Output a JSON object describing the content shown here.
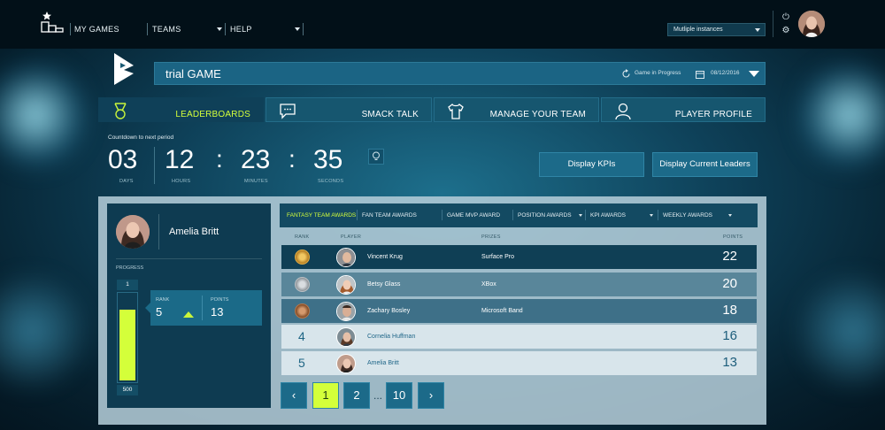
{
  "nav": {
    "my_games": "MY GAMES",
    "teams": "TEAMS",
    "help": "HELP",
    "instances": "Mutliple instances"
  },
  "game": {
    "title": "trial GAME",
    "status": "Game in Progress",
    "date": "08/12/2016"
  },
  "tabs": [
    {
      "label": "LEADERBOARDS",
      "icon": "medal-icon",
      "active": true
    },
    {
      "label": "SMACK TALK",
      "icon": "chat-icon",
      "active": false
    },
    {
      "label": "MANAGE YOUR TEAM",
      "icon": "jersey-icon",
      "active": false
    },
    {
      "label": "PLAYER PROFILE",
      "icon": "person-icon",
      "active": false
    }
  ],
  "countdown": {
    "label": "Countdown to next period",
    "days": "03",
    "hours": "12",
    "minutes": "23",
    "seconds": "35",
    "days_label": "DAYS",
    "hours_label": "HOURS",
    "minutes_label": "MINUTES",
    "seconds_label": "SECONDS"
  },
  "buttons": {
    "display_kpis": "Display KPIs",
    "display_leaders": "Display Current Leaders"
  },
  "profile": {
    "name": "Amelia Britt",
    "progress_label": "PROGRESS",
    "progress_max": "1",
    "progress_min": "500",
    "progress_fraction": 0.82,
    "rank_label": "RANK",
    "rank": "5",
    "points_label": "POINTS",
    "points": "13"
  },
  "awards_tabs": [
    "FANTASY TEAM AWARDS",
    "FAN TEAM AWARDS",
    "GAME MVP AWARD",
    "POSITION AWARDS",
    "KPI AWARDS",
    "WEEKLY AWARDS"
  ],
  "columns": {
    "rank": "RANK",
    "player": "PLAYER",
    "prizes": "PRIZES",
    "points": "POINTS"
  },
  "leaderboard": [
    {
      "rank": "1",
      "player": "Vincent Krug",
      "prize": "Surface Pro",
      "points": "22",
      "medal": "gold"
    },
    {
      "rank": "2",
      "player": "Betsy Glass",
      "prize": "XBox",
      "points": "20",
      "medal": "silver"
    },
    {
      "rank": "3",
      "player": "Zachary Bosley",
      "prize": "Microsoft Band",
      "points": "18",
      "medal": "bronze"
    },
    {
      "rank": "4",
      "player": "Cornelia Huffman",
      "prize": "",
      "points": "16",
      "medal": ""
    },
    {
      "rank": "5",
      "player": "Amelia Britt",
      "prize": "",
      "points": "13",
      "medal": ""
    }
  ],
  "pagination": {
    "prev": "‹",
    "p1": "1",
    "p2": "2",
    "dots": "...",
    "p10": "10",
    "next": "›",
    "current": "1"
  },
  "colors": {
    "accent": "#d4ff3a",
    "panel": "#0e3b51",
    "tab": "#16566f",
    "button": "#1c6a89"
  }
}
